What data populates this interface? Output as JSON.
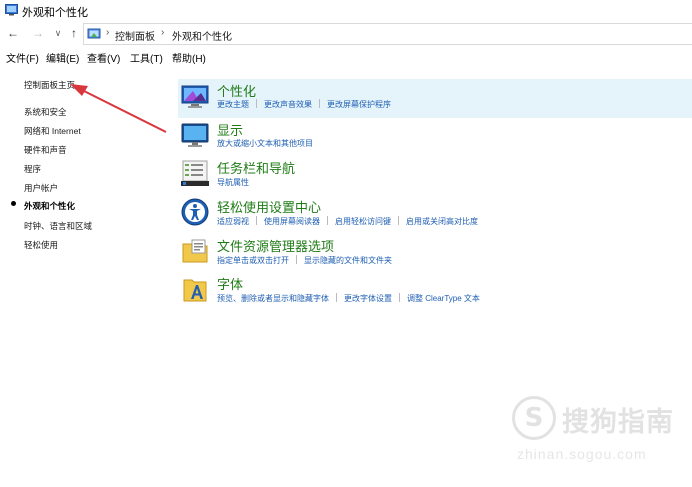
{
  "window": {
    "title": "外观和个性化"
  },
  "address": {
    "crumbs": [
      "控制面板",
      "外观和个性化"
    ]
  },
  "menu": [
    "文件(F)",
    "编辑(E)",
    "查看(V)",
    "工具(T)",
    "帮助(H)"
  ],
  "sidebar": {
    "items": [
      {
        "label": "控制面板主页"
      },
      {
        "label": "系统和安全"
      },
      {
        "label": "网络和 Internet"
      },
      {
        "label": "硬件和声音"
      },
      {
        "label": "程序"
      },
      {
        "label": "用户帐户"
      },
      {
        "label": "外观和个性化",
        "current": true
      },
      {
        "label": "时钟、语言和区域"
      },
      {
        "label": "轻松使用"
      }
    ]
  },
  "categories": [
    {
      "title": "个性化",
      "icon": "personalization-icon",
      "links": [
        "更改主题",
        "更改声音效果",
        "更改屏幕保护程序"
      ]
    },
    {
      "title": "显示",
      "icon": "display-icon",
      "links": [
        "放大或缩小文本和其他项目"
      ]
    },
    {
      "title": "任务栏和导航",
      "icon": "taskbar-icon",
      "links": [
        "导航属性"
      ]
    },
    {
      "title": "轻松使用设置中心",
      "icon": "ease-of-access-icon",
      "links": [
        "适应弱视",
        "使用屏幕阅读器",
        "启用轻松访问键",
        "启用或关闭高对比度"
      ]
    },
    {
      "title": "文件资源管理器选项",
      "icon": "folder-options-icon",
      "links": [
        "指定单击或双击打开",
        "显示隐藏的文件和文件夹"
      ]
    },
    {
      "title": "字体",
      "icon": "fonts-icon",
      "links": [
        "预览、删除或者显示和隐藏字体",
        "更改字体设置",
        "调整 ClearType 文本"
      ]
    }
  ],
  "watermark": {
    "brand": "搜狗指南",
    "url": "zhinan.sogou.com"
  },
  "colors": {
    "title_green": "#1f7b16",
    "link_blue": "#1f5fb3",
    "hover_bg": "#e5f3fb",
    "arrow_red": "#d9363e"
  }
}
